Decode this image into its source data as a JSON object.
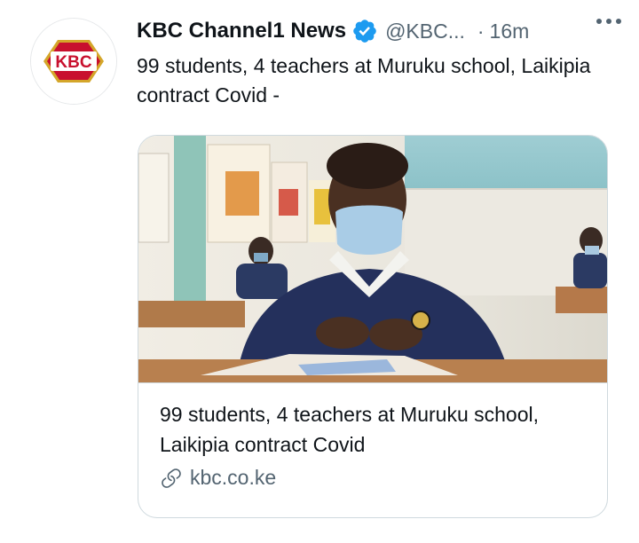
{
  "account": {
    "name": "KBC Channel1 News",
    "handle": "@KBC...",
    "separator": "·",
    "time": "16m",
    "avatar_logo_text": "KBC",
    "verified": true
  },
  "tweet": {
    "text": "99 students, 4 teachers at Muruku school, Laikipia contract Covid -"
  },
  "card": {
    "title": "99 students, 4 teachers at Muruku school, Laikipia contract Covid",
    "domain": "kbc.co.ke",
    "image_alt": "Student wearing a face mask reading at a desk in a classroom"
  },
  "icons": {
    "verified": "verified-badge-icon",
    "more": "more-options-icon",
    "link": "link-icon"
  },
  "colors": {
    "verified_blue": "#1d9bf0",
    "secondary_text": "#536471",
    "primary_text": "#0f1419",
    "card_border": "#cfd9de",
    "logo_red": "#c8102e",
    "logo_gold": "#d4a62a"
  }
}
